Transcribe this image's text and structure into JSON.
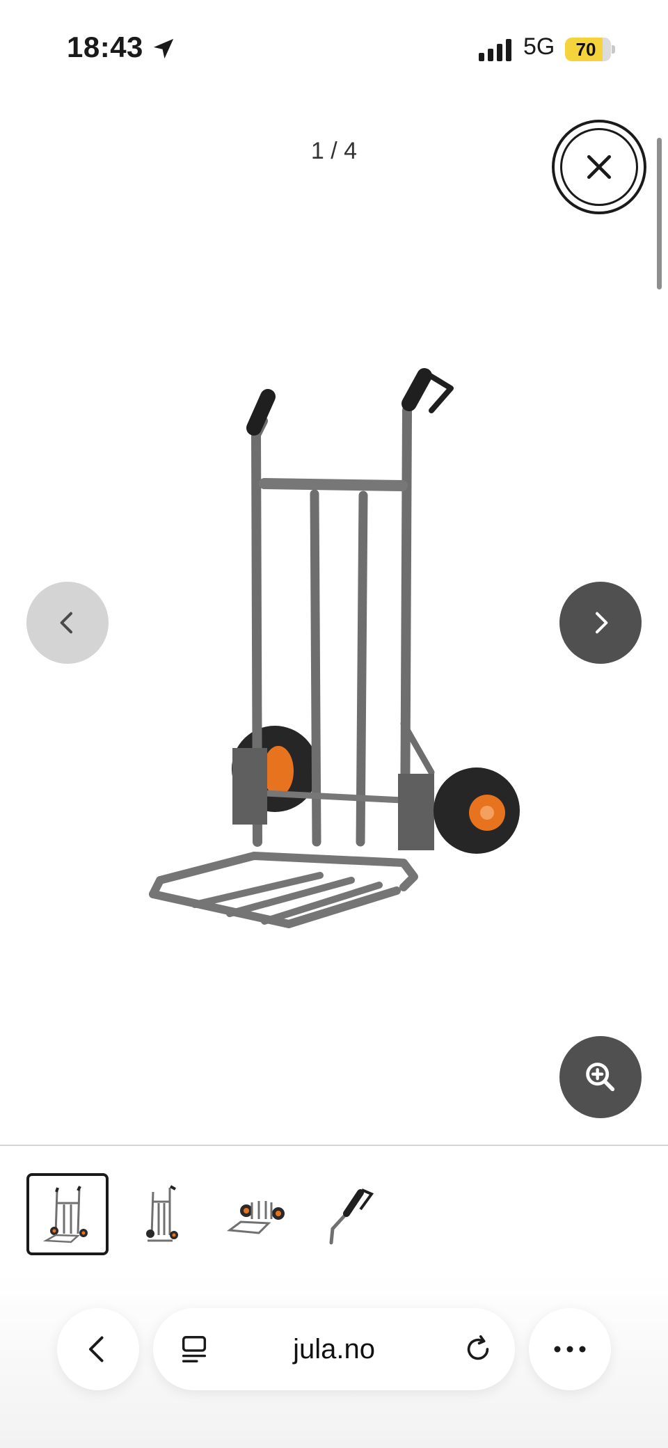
{
  "status_bar": {
    "time": "18:43",
    "network": "5G",
    "battery": "70",
    "battery_color": "#f5d33a"
  },
  "viewer": {
    "counter": "1 / 4",
    "close_icon": "close-icon",
    "prev_icon": "chevron-left-icon",
    "next_icon": "chevron-right-icon",
    "zoom_icon": "zoom-in-icon",
    "image_alt": "Hand truck with orange wheels"
  },
  "thumbnails": [
    {
      "name": "thumbnail-1",
      "selected": true
    },
    {
      "name": "thumbnail-2",
      "selected": false
    },
    {
      "name": "thumbnail-3",
      "selected": false
    },
    {
      "name": "thumbnail-4",
      "selected": false
    }
  ],
  "browser": {
    "url": "jula.no",
    "back_icon": "chevron-left-icon",
    "reader_icon": "reader-icon",
    "reload_icon": "reload-icon",
    "more_icon": "more-icon"
  }
}
